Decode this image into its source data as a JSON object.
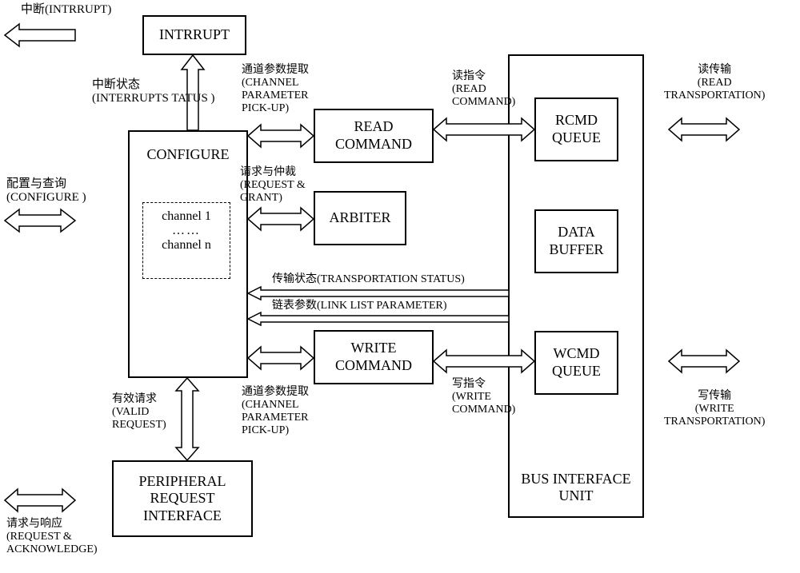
{
  "boxes": {
    "interrupt": "INTRRUPT",
    "configure": "CONFIGURE",
    "channels_top": "channel 1",
    "channels_mid": "……",
    "channels_bot": "channel n",
    "read_command": "READ COMMAND",
    "arbiter": "ARBITER",
    "write_command": "WRITE COMMAND",
    "peripheral": "PERIPHERAL REQUEST INTERFACE",
    "rcmd_queue": "RCMD QUEUE",
    "data_buffer": "DATA BUFFER",
    "wcmd_queue": "WCMD QUEUE",
    "bus_interface": "BUS INTERFACE UNIT"
  },
  "labels": {
    "interrupt_out": "中断(INTRRUPT)",
    "interrupt_status_cn": "中断状态",
    "interrupt_status_en": "(INTERRUPTS TATUS )",
    "channel_param_cn": "通道参数提取",
    "channel_param_en1": "(CHANNEL",
    "channel_param_en2": "PARAMETER",
    "channel_param_en3": "PICK-UP)",
    "read_cmd_cn": "读指令",
    "read_cmd_en1": "(READ",
    "read_cmd_en2": "COMMAND)",
    "read_trans_cn": "读传输",
    "read_trans_en1": "(READ",
    "read_trans_en2": "TRANSPORTATION)",
    "configure_cn": "配置与查询",
    "configure_en": "(CONFIGURE )",
    "request_grant_cn": "请求与仲裁",
    "request_grant_en1": "(REQUEST &",
    "request_grant_en2": "GRANT)",
    "trans_status_cn": "传输状态",
    "trans_status_en": "(TRANSPORTATION STATUS)",
    "linklist_cn": "链表参数",
    "linklist_en": "(LINK LIST PARAMETER)",
    "write_cmd_cn": "写指令",
    "write_cmd_en1": "(WRITE",
    "write_cmd_en2": "COMMAND)",
    "write_trans_cn": "写传输",
    "write_trans_en1": "(WRITE",
    "write_trans_en2": "TRANSPORTATION)",
    "valid_req_cn": "有效请求",
    "valid_req_en1": "(VALID",
    "valid_req_en2": "REQUEST)",
    "channel_param2_cn": "通道参数提取",
    "channel_param2_en1": "(CHANNEL",
    "channel_param2_en2": "PARAMETER",
    "channel_param2_en3": "PICK-UP)",
    "req_ack_cn": "请求与响应",
    "req_ack_en1": "(REQUEST &",
    "req_ack_en2": "ACKNOWLEDGE)"
  }
}
